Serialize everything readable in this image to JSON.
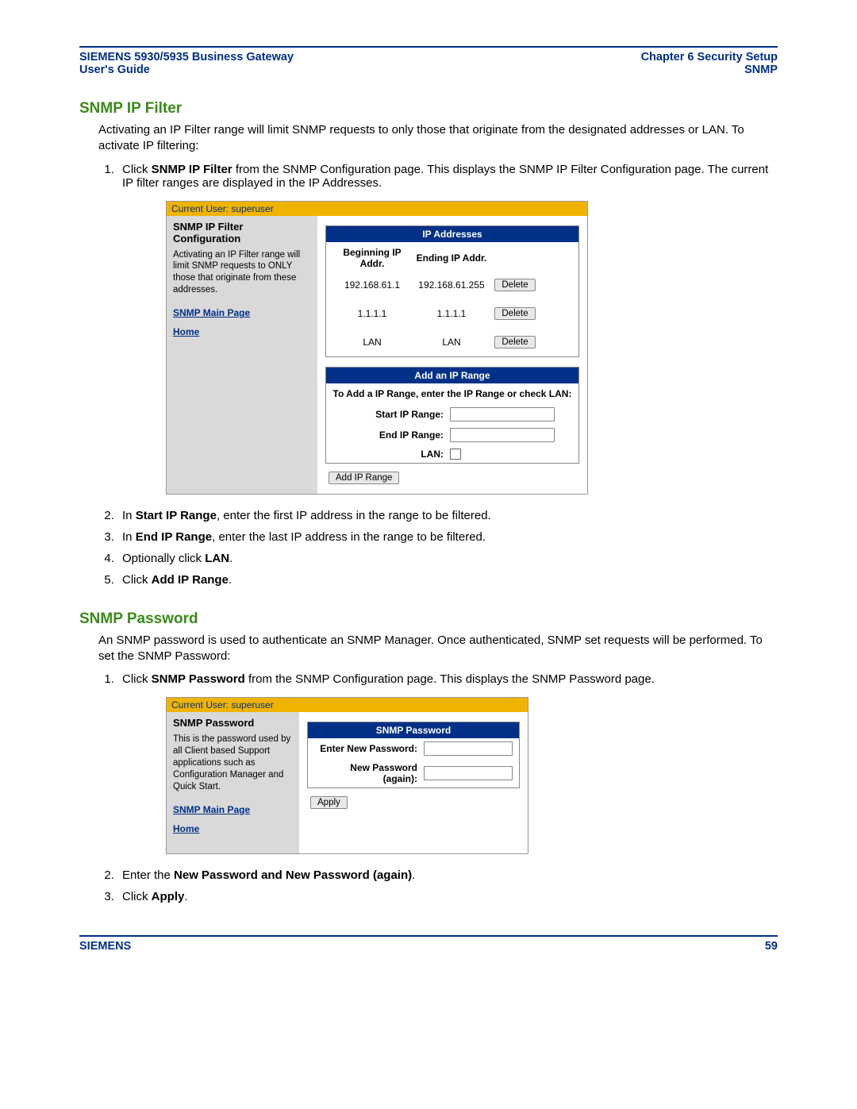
{
  "header": {
    "left_line1": "SIEMENS 5930/5935 Business Gateway",
    "left_line2": "User's Guide",
    "right_line1": "Chapter 6  Security Setup",
    "right_line2": "SNMP"
  },
  "section1": {
    "title": "SNMP IP Filter",
    "intro": "Activating an IP Filter range will limit SNMP requests to only those that originate from the designated addresses or LAN. To activate IP filtering:",
    "step1_a": "Click ",
    "step1_b": "SNMP IP Filter",
    "step1_c": " from the SNMP Configuration page. This displays the SNMP IP Filter Configuration page. The current IP filter ranges are displayed in the IP Addresses."
  },
  "shot1": {
    "current_user": "Current User: superuser",
    "side_title": "SNMP IP Filter Configuration",
    "side_desc": "Activating an IP Filter range will limit SNMP requests to ONLY those that originate from these addresses.",
    "link1": "SNMP Main Page",
    "link2": "Home",
    "ip_header": "IP Addresses",
    "col_begin": "Beginning IP Addr.",
    "col_end": "Ending IP Addr.",
    "rows": [
      {
        "begin": "192.168.61.1",
        "end": "192.168.61.255",
        "del": "Delete"
      },
      {
        "begin": "1.1.1.1",
        "end": "1.1.1.1",
        "del": "Delete"
      },
      {
        "begin": "LAN",
        "end": "LAN",
        "del": "Delete"
      }
    ],
    "add_header": "Add an IP Range",
    "add_instr": "To Add a IP Range, enter the IP Range or check LAN:",
    "start_lbl": "Start IP Range:",
    "end_lbl": "End IP Range:",
    "lan_lbl": "LAN:",
    "add_btn": "Add IP Range"
  },
  "steps_after1": {
    "s2_a": "In ",
    "s2_b": "Start IP Range",
    "s2_c": ", enter the first IP address in the range to be filtered.",
    "s3_a": "In ",
    "s3_b": "End IP Range",
    "s3_c": ", enter the last IP address in the range to be filtered.",
    "s4_a": "Optionally click ",
    "s4_b": "LAN",
    "s4_c": ".",
    "s5_a": "Click ",
    "s5_b": "Add IP Range",
    "s5_c": "."
  },
  "section2": {
    "title": "SNMP Password",
    "intro": "An SNMP password is used to authenticate an SNMP Manager. Once authenticated, SNMP set requests will be performed. To set the SNMP Password:",
    "step1_a": "Click ",
    "step1_b": "SNMP Password",
    "step1_c": " from the SNMP Configuration page. This displays the SNMP Password page."
  },
  "shot2": {
    "current_user": "Current User: superuser",
    "side_title": "SNMP Password",
    "side_desc": "This is the password used by all Client based Support applications such as Configuration Manager and Quick Start.",
    "link1": "SNMP Main Page",
    "link2": "Home",
    "pwd_header": "SNMP Password",
    "new_pwd": "Enter New Password:",
    "new_pwd2": "New Password (again):",
    "apply": "Apply"
  },
  "steps_after2": {
    "s2_a": "Enter the ",
    "s2_b": "New Password and New Password (again)",
    "s2_c": ".",
    "s3_a": "Click ",
    "s3_b": "Apply",
    "s3_c": "."
  },
  "footer": {
    "left": "SIEMENS",
    "right": "59"
  }
}
